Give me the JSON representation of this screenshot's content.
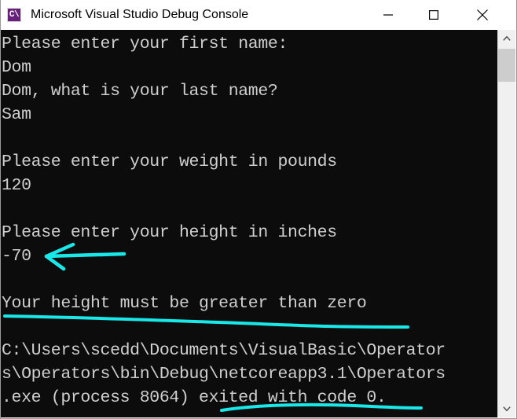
{
  "window": {
    "title": "Microsoft Visual Studio Debug Console",
    "icon_name": "visual-studio-console-icon",
    "icon_glyph": "C\\",
    "icon_color": "#68217a",
    "controls": {
      "minimize_label": "Minimize",
      "maximize_label": "Maximize",
      "close_label": "Close"
    }
  },
  "console": {
    "background_color": "#0c0c0c",
    "text_color": "#cfcfcf",
    "lines": [
      "Please enter your first name:",
      "Dom",
      "Dom, what is your last name?",
      "Sam",
      "",
      "Please enter your weight in pounds",
      "120",
      "",
      "Please enter your height in inches",
      "-70",
      "",
      "Your height must be greater than zero",
      "",
      "C:\\Users\\scedd\\Documents\\VisualBasic\\Operator",
      "s\\Operators\\bin\\Debug\\netcoreapp3.1\\Operators",
      ".exe (process 8064) exited with code 0."
    ],
    "text": "Please enter your first name:\nDom\nDom, what is your last name?\nSam\n\nPlease enter your weight in pounds\n120\n\nPlease enter your height in inches\n-70\n\nYour height must be greater than zero\n\nC:\\Users\\scedd\\Documents\\VisualBasic\\Operator\ns\\Operators\\bin\\Debug\\netcoreapp3.1\\Operators\n.exe (process 8064) exited with code 0."
  },
  "annotations": {
    "color": "#18e8e8",
    "items": [
      {
        "name": "arrow-pointing-to-negative-height",
        "type": "arrow",
        "points_at": "-70",
        "description": "Hand-drawn cyan left arrow pointing at the invalid input value -70"
      },
      {
        "name": "underline-height-error-message",
        "type": "underline",
        "underlines": "Your height must be greater than zero",
        "description": "Hand-drawn cyan underline beneath the validation error message"
      },
      {
        "name": "underline-exit-code",
        "type": "underline",
        "underlines": "exited with code 0.",
        "description": "Hand-drawn cyan underline beneath the process exit code text"
      }
    ]
  },
  "scrollbar": {
    "name": "console-vertical-scrollbar",
    "up_arrow_label": "Scroll up",
    "down_arrow_label": "Scroll down",
    "thumb_label": "Scroll thumb"
  }
}
